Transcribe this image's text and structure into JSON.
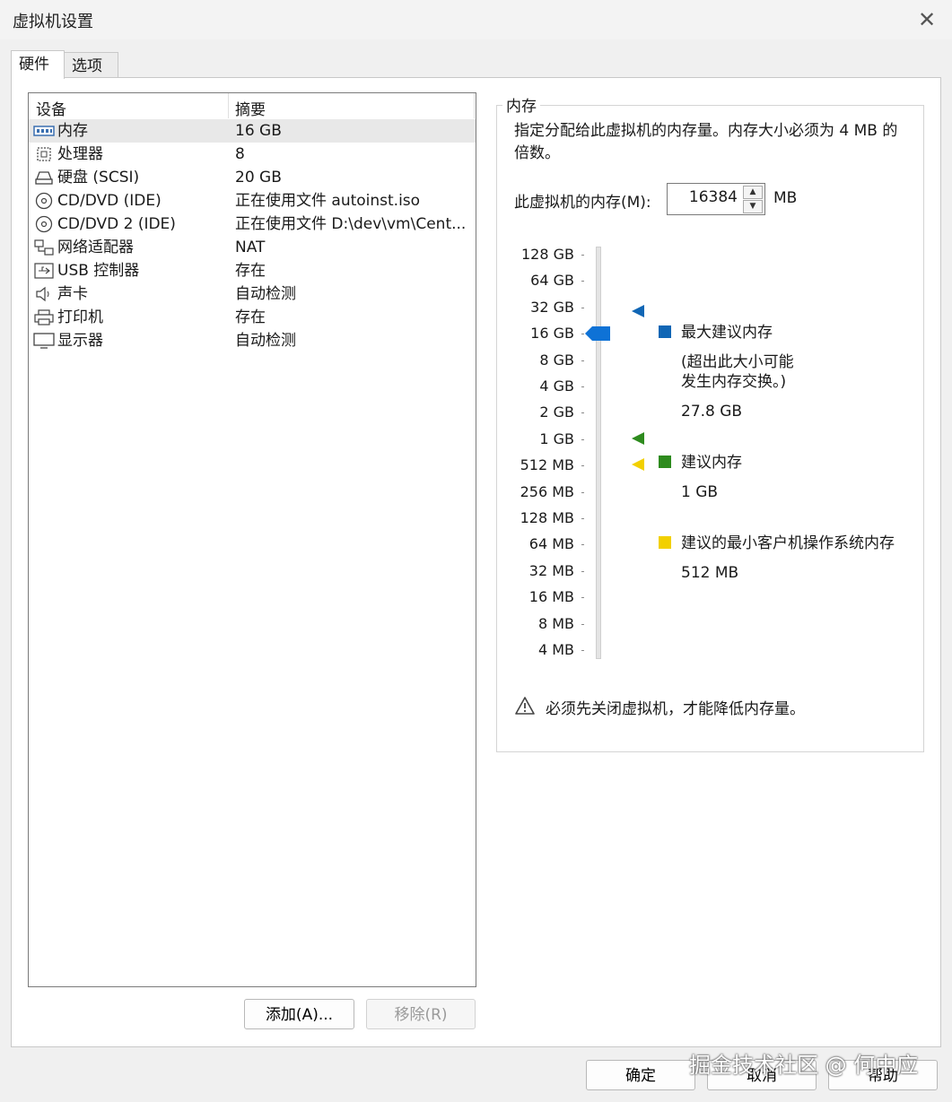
{
  "window": {
    "title": "虚拟机设置"
  },
  "tabs": [
    {
      "label": "硬件",
      "active": true
    },
    {
      "label": "选项",
      "active": false
    }
  ],
  "device_list": {
    "columns": {
      "device": "设备",
      "summary": "摘要"
    },
    "rows": [
      {
        "name": "内存",
        "summary": "16 GB",
        "icon": "memory-icon",
        "selected": true
      },
      {
        "name": "处理器",
        "summary": "8",
        "icon": "processor-icon"
      },
      {
        "name": "硬盘 (SCSI)",
        "summary": "20 GB",
        "icon": "hard-disk-icon"
      },
      {
        "name": "CD/DVD (IDE)",
        "summary": "正在使用文件 autoinst.iso",
        "icon": "cd-dvd-icon"
      },
      {
        "name": "CD/DVD 2 (IDE)",
        "summary": "正在使用文件 D:\\dev\\vm\\Cent...",
        "icon": "cd-dvd-icon"
      },
      {
        "name": "网络适配器",
        "summary": "NAT",
        "icon": "network-adapter-icon"
      },
      {
        "name": "USB 控制器",
        "summary": "存在",
        "icon": "usb-icon"
      },
      {
        "name": "声卡",
        "summary": "自动检测",
        "icon": "speaker-icon"
      },
      {
        "name": "打印机",
        "summary": "存在",
        "icon": "printer-icon"
      },
      {
        "name": "显示器",
        "summary": "自动检测",
        "icon": "monitor-icon"
      }
    ],
    "add_button": "添加(A)...",
    "remove_button": "移除(R)"
  },
  "memory": {
    "group_title": "内存",
    "description": "指定分配给此虚拟机的内存量。内存大小必须为 4 MB 的倍数。",
    "field_label": "此虚拟机的内存(M):",
    "value": "16384",
    "unit": "MB",
    "scale_labels": [
      "128 GB",
      "64 GB",
      "32 GB",
      "16 GB",
      "8 GB",
      "4 GB",
      "2 GB",
      "1 GB",
      "512 MB",
      "256 MB",
      "128 MB",
      "64 MB",
      "32 MB",
      "16 MB",
      "8 MB",
      "4 MB"
    ],
    "max_recommended": {
      "label": "最大建议内存",
      "note_line1": "(超出此大小可能",
      "note_line2": "发生内存交换。)",
      "value": "27.8 GB",
      "color": "#1066b5"
    },
    "recommended": {
      "label": "建议内存",
      "value": "1 GB",
      "color": "#2e8b1e"
    },
    "min_recommended": {
      "label": "建议的最小客户机操作系统内存",
      "value": "512 MB",
      "color": "#f2d000"
    },
    "warning": "必须先关闭虚拟机，才能降低内存量。"
  },
  "footer": {
    "ok": "确定",
    "cancel": "取消",
    "help": "帮助"
  },
  "watermark": "掘金技术社区 @ 何中应"
}
